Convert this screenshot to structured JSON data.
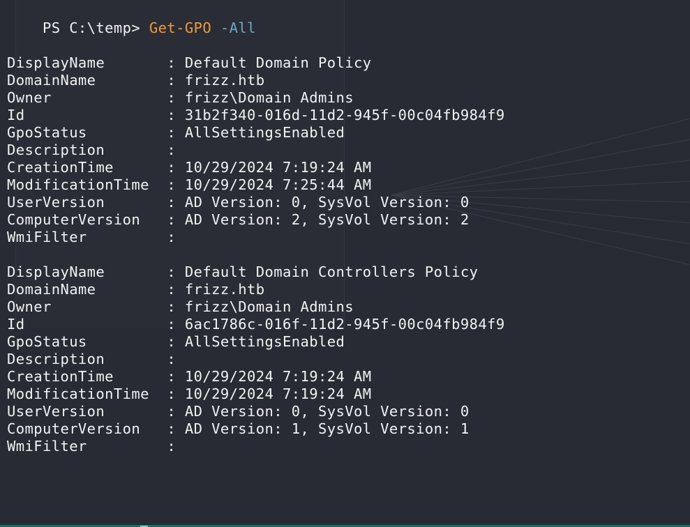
{
  "terminal": {
    "prompt": "PS C:\\temp>",
    "command": {
      "name": "Get-GPO",
      "param": "-All"
    },
    "separator": " : ",
    "gpos": [
      {
        "fields": [
          {
            "key": "DisplayName",
            "value": "Default Domain Policy"
          },
          {
            "key": "DomainName",
            "value": "frizz.htb"
          },
          {
            "key": "Owner",
            "value": "frizz\\Domain Admins"
          },
          {
            "key": "Id",
            "value": "31b2f340-016d-11d2-945f-00c04fb984f9"
          },
          {
            "key": "GpoStatus",
            "value": "AllSettingsEnabled"
          },
          {
            "key": "Description",
            "value": ""
          },
          {
            "key": "CreationTime",
            "value": "10/29/2024 7:19:24 AM"
          },
          {
            "key": "ModificationTime",
            "value": "10/29/2024 7:25:44 AM"
          },
          {
            "key": "UserVersion",
            "value": "AD Version: 0, SysVol Version: 0"
          },
          {
            "key": "ComputerVersion",
            "value": "AD Version: 2, SysVol Version: 2"
          },
          {
            "key": "WmiFilter",
            "value": ""
          }
        ]
      },
      {
        "fields": [
          {
            "key": "DisplayName",
            "value": "Default Domain Controllers Policy"
          },
          {
            "key": "DomainName",
            "value": "frizz.htb"
          },
          {
            "key": "Owner",
            "value": "frizz\\Domain Admins"
          },
          {
            "key": "Id",
            "value": "6ac1786c-016f-11d2-945f-00c04fb984f9"
          },
          {
            "key": "GpoStatus",
            "value": "AllSettingsEnabled"
          },
          {
            "key": "Description",
            "value": ""
          },
          {
            "key": "CreationTime",
            "value": "10/29/2024 7:19:24 AM"
          },
          {
            "key": "ModificationTime",
            "value": "10/29/2024 7:19:24 AM"
          },
          {
            "key": "UserVersion",
            "value": "AD Version: 0, SysVol Version: 0"
          },
          {
            "key": "ComputerVersion",
            "value": "AD Version: 1, SysVol Version: 1"
          },
          {
            "key": "WmiFilter",
            "value": ""
          }
        ]
      }
    ],
    "colors": {
      "background": "#282b34",
      "text": "#f2f2f2",
      "command": "#f29a38",
      "parameter": "#6ea7c8"
    }
  }
}
